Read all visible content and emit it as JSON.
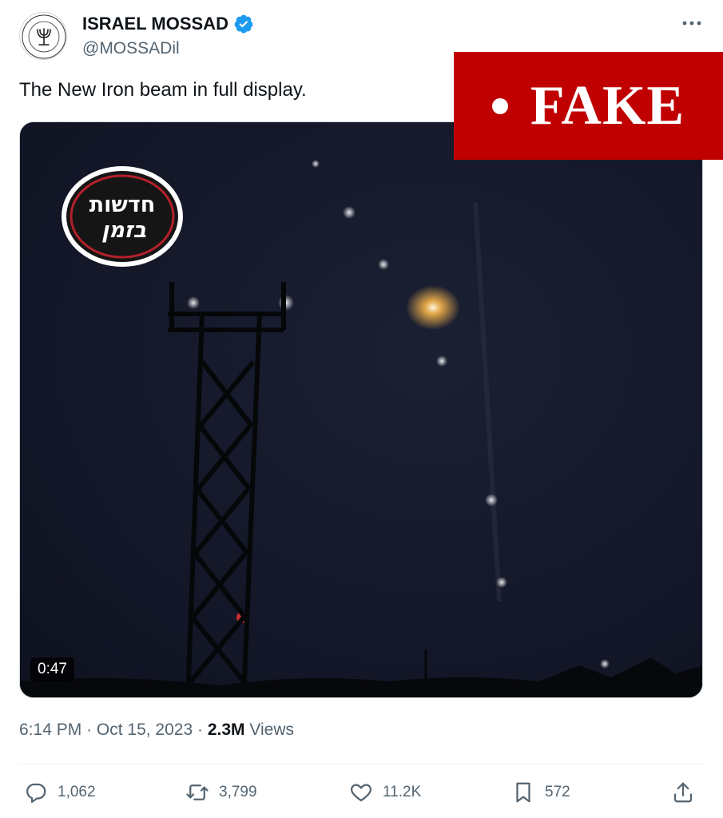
{
  "author": {
    "name": "ISRAEL MOSSAD",
    "handle": "@MOSSADil",
    "verified_color": "#1d9bf0"
  },
  "tweet": {
    "text": "The New Iron beam in full display."
  },
  "media": {
    "duration": "0:47",
    "channel_logo_lines": [
      "חדשות",
      "בזמן"
    ]
  },
  "overlay": {
    "label": "FAKE",
    "color": "#c00000"
  },
  "meta": {
    "time": "6:14 PM",
    "date": "Oct 15, 2023",
    "separator": "·",
    "views_count": "2.3M",
    "views_label": "Views"
  },
  "actions": {
    "replies": "1,062",
    "reposts": "3,799",
    "likes": "11.2K",
    "bookmarks": "572"
  },
  "icons": {
    "more": "more-icon",
    "reply": "reply-icon",
    "repost": "repost-icon",
    "like": "heart-icon",
    "bookmark": "bookmark-icon",
    "share": "share-icon",
    "verified": "verified-badge-icon"
  }
}
